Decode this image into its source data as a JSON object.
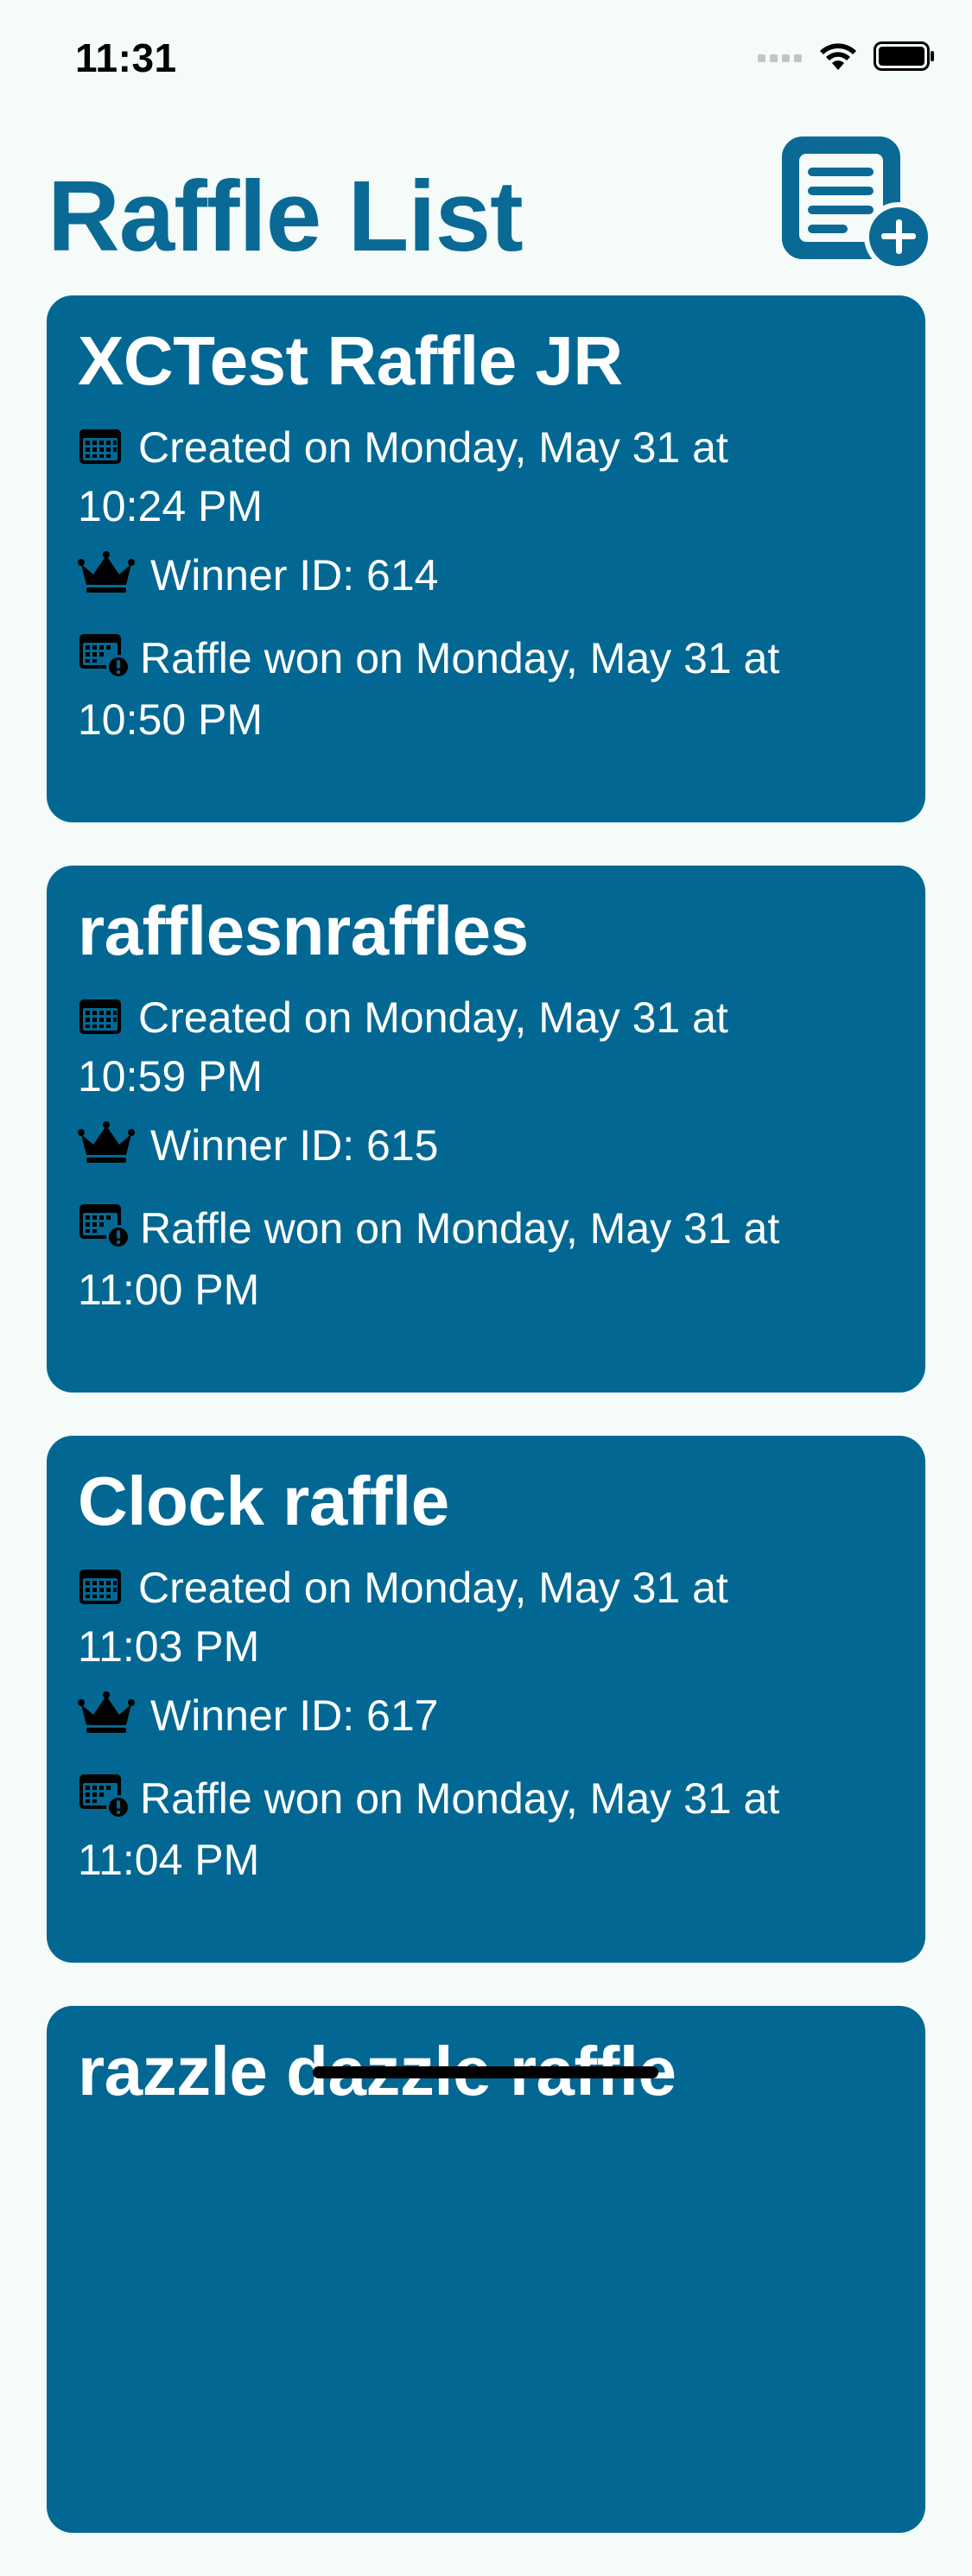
{
  "status_bar": {
    "time": "11:31"
  },
  "header": {
    "title": "Raffle List",
    "add_icon": "add-list-icon"
  },
  "colors": {
    "background": "#f4fbf9",
    "accent": "#026893",
    "card_text": "#ffffff"
  },
  "raffles": [
    {
      "name": "XCTest Raffle JR",
      "created_line1": "Created on Monday, May 31 at",
      "created_line2": "10:24 PM",
      "winner": "Winner ID: 614",
      "won_line1": "Raffle won on Monday, May 31 at",
      "won_line2": "10:50 PM"
    },
    {
      "name": "rafflesnraffles",
      "created_line1": "Created on Monday, May 31 at",
      "created_line2": "10:59 PM",
      "winner": "Winner ID: 615",
      "won_line1": "Raffle won on Monday, May 31 at",
      "won_line2": "11:00 PM"
    },
    {
      "name": "Clock raffle",
      "created_line1": "Created on Monday, May 31 at",
      "created_line2": "11:03 PM",
      "winner": "Winner ID: 617",
      "won_line1": "Raffle won on Monday, May 31 at",
      "won_line2": "11:04 PM"
    },
    {
      "name": "razzle dazzle raffle"
    }
  ]
}
